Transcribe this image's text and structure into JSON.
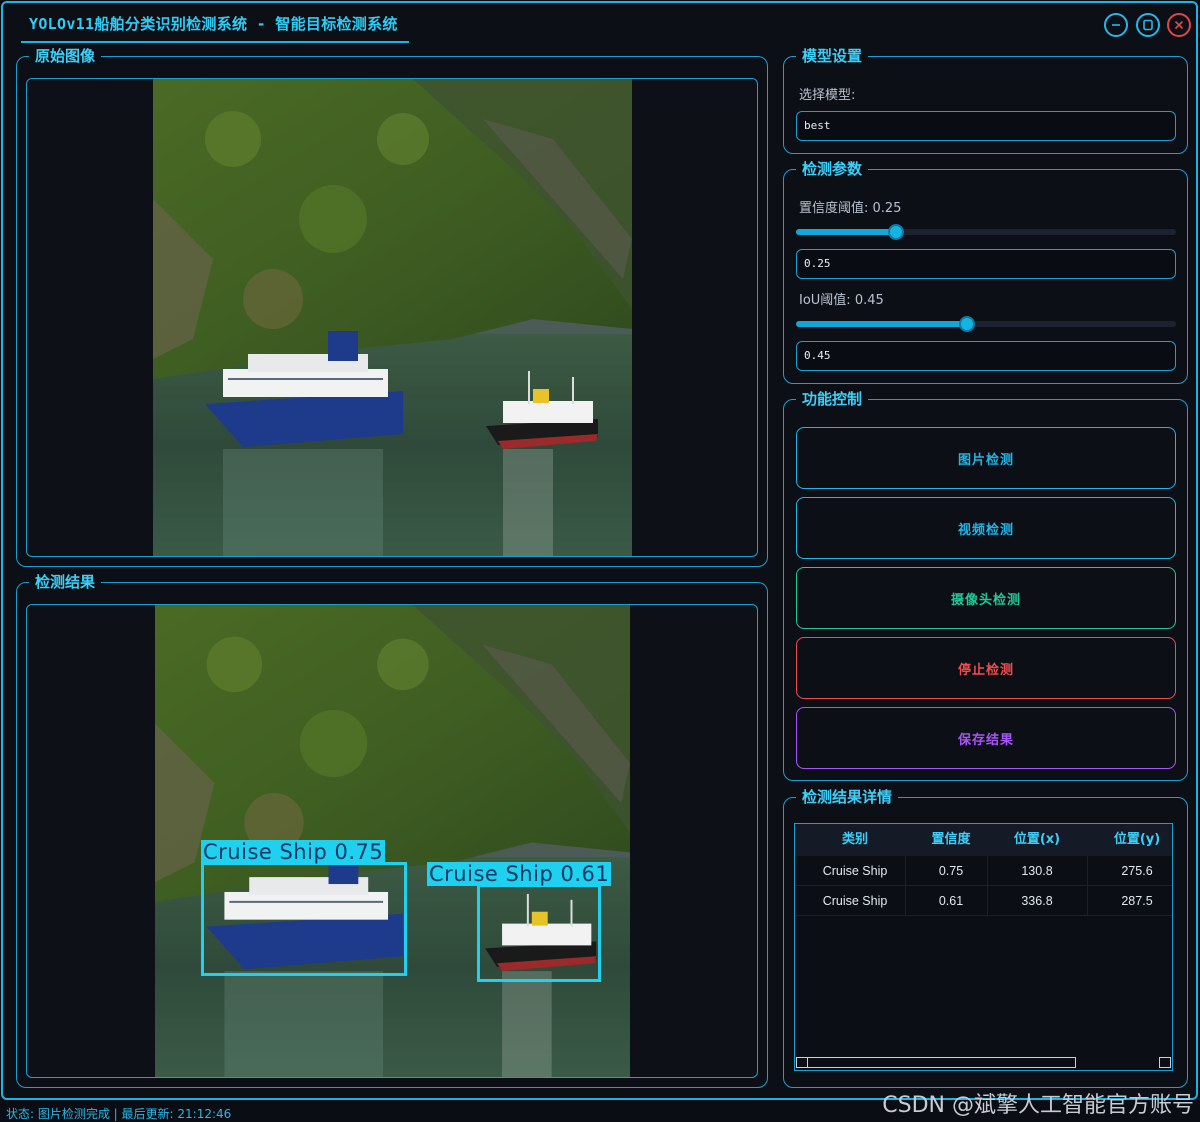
{
  "window": {
    "title": "YOLOv11船舶分类识别检测系统 - 智能目标检测系统",
    "accent": "#18b6e0",
    "controls": [
      "minimize-icon",
      "maximize-icon",
      "close-icon"
    ]
  },
  "original_panel": {
    "title": "原始图像"
  },
  "result_panel": {
    "title": "检测结果",
    "detections": [
      {
        "label": "Cruise Ship 0.75"
      },
      {
        "label": "Cruise Ship 0.61"
      }
    ]
  },
  "model_settings": {
    "title": "模型设置",
    "select_label": "选择模型:",
    "selected_model": "best"
  },
  "detect_params": {
    "title": "检测参数",
    "confidence": {
      "label": "置信度阈值: 0.25",
      "value": 0.25,
      "input": "0.25"
    },
    "iou": {
      "label": "IoU阈值: 0.45",
      "value": 0.45,
      "input": "0.45"
    }
  },
  "function_control": {
    "title": "功能控制",
    "buttons": [
      {
        "label": "图片检测",
        "color": "#1fb6e6"
      },
      {
        "label": "视频检测",
        "color": "#1fb6e6"
      },
      {
        "label": "摄像头检测",
        "color": "#20c997"
      },
      {
        "label": "停止检测",
        "color": "#ef4d4d"
      },
      {
        "label": "保存结果",
        "color": "#a855f7"
      }
    ]
  },
  "result_details": {
    "title": "检测结果详情",
    "columns": [
      "类别",
      "置信度",
      "位置(x)",
      "位置(y)"
    ],
    "rows": [
      [
        "Cruise Ship",
        "0.75",
        "130.8",
        "275.6"
      ],
      [
        "Cruise Ship",
        "0.61",
        "336.8",
        "287.5"
      ]
    ]
  },
  "status_bar": {
    "text": "状态: 图片检测完成 | 最后更新: 21:12:46"
  },
  "watermark": "CSDN @斌擎人工智能官方账号"
}
